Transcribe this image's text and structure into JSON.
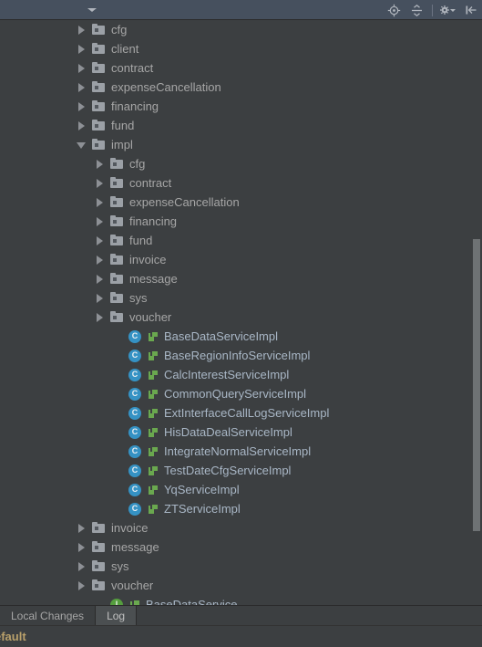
{
  "toolbar": {
    "dropdown_caret_name": "chevron-down-icon",
    "buttons": [
      {
        "name": "scroll-from-source-icon",
        "title": "Select Opened File"
      },
      {
        "name": "collapse-all-icon",
        "title": "Collapse All"
      },
      {
        "name": "settings-gear-icon",
        "title": "Settings"
      },
      {
        "name": "hide-panel-icon",
        "title": "Hide"
      }
    ]
  },
  "colors": {
    "toolbar_bg": "#46505e",
    "tree_bg": "#3c3f41",
    "folder": "#9ba0a6",
    "class_icon": "#3592c4",
    "interface_icon": "#559e3e",
    "impl_marker": "#6aa84f",
    "text": "#a6a6a6",
    "class_text": "#a9b7c6",
    "status_text": "#b9a06a",
    "scrollbar": "#6e7274"
  },
  "tree": {
    "rows": [
      {
        "label": "cfg",
        "depth": 1,
        "type": "folder",
        "state": "closed"
      },
      {
        "label": "client",
        "depth": 1,
        "type": "folder",
        "state": "closed"
      },
      {
        "label": "contract",
        "depth": 1,
        "type": "folder",
        "state": "closed"
      },
      {
        "label": "expenseCancellation",
        "depth": 1,
        "type": "folder",
        "state": "closed"
      },
      {
        "label": "financing",
        "depth": 1,
        "type": "folder",
        "state": "closed"
      },
      {
        "label": "fund",
        "depth": 1,
        "type": "folder",
        "state": "closed"
      },
      {
        "label": "impl",
        "depth": 1,
        "type": "folder",
        "state": "open"
      },
      {
        "label": "cfg",
        "depth": 2,
        "type": "folder",
        "state": "closed"
      },
      {
        "label": "contract",
        "depth": 2,
        "type": "folder",
        "state": "closed"
      },
      {
        "label": "expenseCancellation",
        "depth": 2,
        "type": "folder",
        "state": "closed"
      },
      {
        "label": "financing",
        "depth": 2,
        "type": "folder",
        "state": "closed"
      },
      {
        "label": "fund",
        "depth": 2,
        "type": "folder",
        "state": "closed"
      },
      {
        "label": "invoice",
        "depth": 2,
        "type": "folder",
        "state": "closed"
      },
      {
        "label": "message",
        "depth": 2,
        "type": "folder",
        "state": "closed"
      },
      {
        "label": "sys",
        "depth": 2,
        "type": "folder",
        "state": "closed"
      },
      {
        "label": "voucher",
        "depth": 2,
        "type": "folder",
        "state": "closed"
      },
      {
        "label": "BaseDataServiceImpl",
        "depth": 3,
        "type": "class",
        "state": "leaf"
      },
      {
        "label": "BaseRegionInfoServiceImpl",
        "depth": 3,
        "type": "class",
        "state": "leaf"
      },
      {
        "label": "CalcInterestServiceImpl",
        "depth": 3,
        "type": "class",
        "state": "leaf"
      },
      {
        "label": "CommonQueryServiceImpl",
        "depth": 3,
        "type": "class",
        "state": "leaf"
      },
      {
        "label": "ExtInterfaceCallLogServiceImpl",
        "depth": 3,
        "type": "class",
        "state": "leaf"
      },
      {
        "label": "HisDataDealServiceImpl",
        "depth": 3,
        "type": "class",
        "state": "leaf"
      },
      {
        "label": "IntegrateNormalServiceImpl",
        "depth": 3,
        "type": "class",
        "state": "leaf"
      },
      {
        "label": "TestDateCfgServiceImpl",
        "depth": 3,
        "type": "class",
        "state": "leaf"
      },
      {
        "label": "YqServiceImpl",
        "depth": 3,
        "type": "class",
        "state": "leaf"
      },
      {
        "label": "ZTServiceImpl",
        "depth": 3,
        "type": "class",
        "state": "leaf"
      },
      {
        "label": "invoice",
        "depth": 1,
        "type": "folder",
        "state": "closed"
      },
      {
        "label": "message",
        "depth": 1,
        "type": "folder",
        "state": "closed"
      },
      {
        "label": "sys",
        "depth": 1,
        "type": "folder",
        "state": "closed"
      },
      {
        "label": "voucher",
        "depth": 1,
        "type": "folder",
        "state": "closed"
      },
      {
        "label": "BaseDataService",
        "depth": 2,
        "type": "interface",
        "state": "leaf"
      }
    ]
  },
  "bottom_tabs": {
    "tabs": [
      {
        "label": "Local Changes",
        "selected": false
      },
      {
        "label": "Log",
        "selected": true
      }
    ]
  },
  "status_bar": {
    "text": "efault"
  }
}
